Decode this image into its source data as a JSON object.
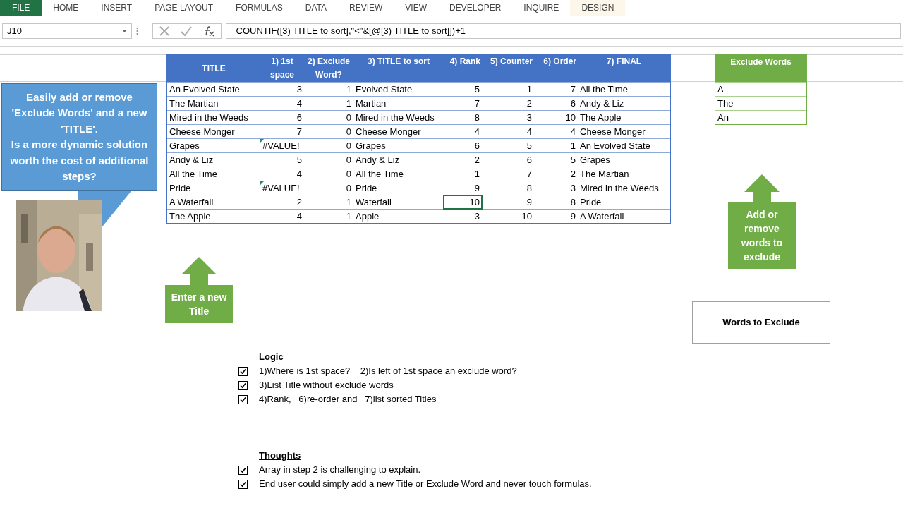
{
  "ribbon": {
    "tabs": [
      {
        "label": "FILE",
        "kind": "file"
      },
      {
        "label": "HOME",
        "kind": "normal"
      },
      {
        "label": "INSERT",
        "kind": "normal"
      },
      {
        "label": "PAGE LAYOUT",
        "kind": "normal"
      },
      {
        "label": "FORMULAS",
        "kind": "normal"
      },
      {
        "label": "DATA",
        "kind": "normal"
      },
      {
        "label": "REVIEW",
        "kind": "normal"
      },
      {
        "label": "VIEW",
        "kind": "normal"
      },
      {
        "label": "DEVELOPER",
        "kind": "normal"
      },
      {
        "label": "INQUIRE",
        "kind": "normal"
      },
      {
        "label": "DESIGN",
        "kind": "contextual"
      }
    ]
  },
  "formula_bar": {
    "name_box": "J10",
    "formula": "=COUNTIF([3) TITLE to sort],\"<\"&[@[3) TITLE to sort]])+1"
  },
  "main_table": {
    "columns": [
      "TITLE",
      "1) 1st space",
      "2) Exclude Word?",
      "3) TITLE to sort",
      "4) Rank",
      "5) Counter",
      "6) Order",
      "7) FINAL"
    ],
    "rows": [
      {
        "cells": [
          "An Evolved State",
          "3",
          "1",
          "Evolved State",
          "5",
          "1",
          "7",
          "All the Time"
        ],
        "error_flag": false,
        "selected": false
      },
      {
        "cells": [
          "The Martian",
          "4",
          "1",
          "Martian",
          "7",
          "2",
          "6",
          "Andy & Liz"
        ],
        "error_flag": false,
        "selected": false
      },
      {
        "cells": [
          "Mired in the Weeds",
          "6",
          "0",
          "Mired in the Weeds",
          "8",
          "3",
          "10",
          "The Apple"
        ],
        "error_flag": false,
        "selected": false
      },
      {
        "cells": [
          "Cheese Monger",
          "7",
          "0",
          "Cheese Monger",
          "4",
          "4",
          "4",
          "Cheese Monger"
        ],
        "error_flag": false,
        "selected": false
      },
      {
        "cells": [
          "Grapes",
          "#VALUE!",
          "0",
          "Grapes",
          "6",
          "5",
          "1",
          "An Evolved State"
        ],
        "error_flag": true,
        "selected": false
      },
      {
        "cells": [
          "Andy & Liz",
          "5",
          "0",
          "Andy & Liz",
          "2",
          "6",
          "5",
          "Grapes"
        ],
        "error_flag": false,
        "selected": false
      },
      {
        "cells": [
          "All the Time",
          "4",
          "0",
          "All the Time",
          "1",
          "7",
          "2",
          "The Martian"
        ],
        "error_flag": false,
        "selected": false
      },
      {
        "cells": [
          "Pride",
          "#VALUE!",
          "0",
          "Pride",
          "9",
          "8",
          "3",
          "Mired in the Weeds"
        ],
        "error_flag": true,
        "selected": false
      },
      {
        "cells": [
          "A Waterfall",
          "2",
          "1",
          "Waterfall",
          "10",
          "9",
          "8",
          "Pride"
        ],
        "error_flag": false,
        "selected": true
      },
      {
        "cells": [
          "The Apple",
          "4",
          "1",
          "Apple",
          "3",
          "10",
          "9",
          "A Waterfall"
        ],
        "error_flag": false,
        "selected": false
      }
    ]
  },
  "exclude_table": {
    "header": "Exclude Words",
    "rows": [
      "A",
      "The",
      "An"
    ]
  },
  "callout": "Easily add or remove 'Exclude Words' and a new 'TITLE'.\nIs a more dynamic solution worth the cost of additional steps?",
  "arrow_left": "Enter a new Title",
  "arrow_right": "Add or remove words to exclude",
  "words_box": "Words to Exclude",
  "logic": {
    "heading": "Logic",
    "items": [
      {
        "text": "1)Where is 1st space?    2)Is left of 1st space an exclude word?",
        "checked": true
      },
      {
        "text": "3)List Title without exclude words",
        "checked": true
      },
      {
        "text": "4)Rank,   6)re-order and   7)list sorted Titles",
        "checked": true
      }
    ]
  },
  "thoughts": {
    "heading": "Thoughts",
    "items": [
      {
        "text": "Array in step 2 is challenging to explain.",
        "checked": true
      },
      {
        "text": "End user could simply add a new Title or Exclude Word and never touch formulas.",
        "checked": true
      }
    ]
  }
}
